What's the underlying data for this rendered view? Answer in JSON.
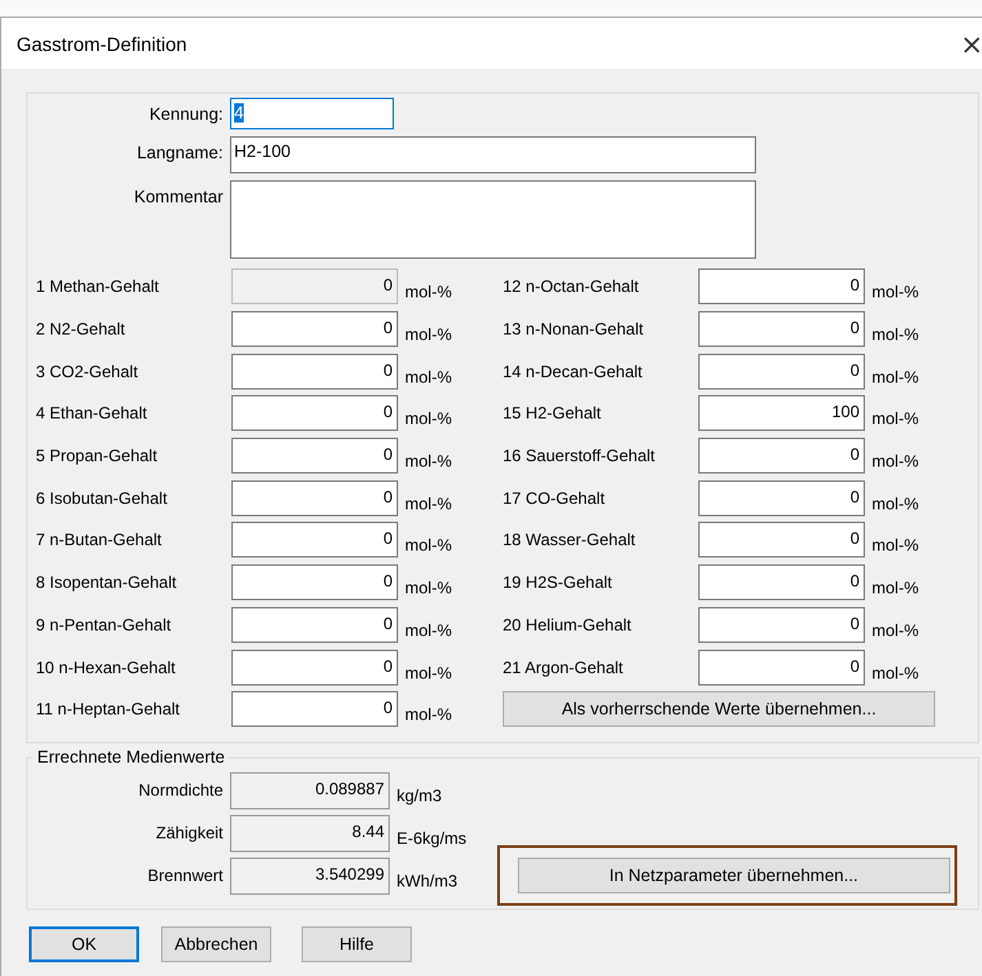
{
  "window": {
    "title": "Gasstrom-Definition",
    "close": "×"
  },
  "header_fields": [
    {
      "label": "Kennung:",
      "value": "4",
      "kind": "short",
      "focused": true,
      "text_selected": true
    },
    {
      "label": "Langname:",
      "value": "H2-100",
      "kind": "long",
      "focused": false
    },
    {
      "label": "Kommentar",
      "kind": "area",
      "focused": false
    }
  ],
  "components_left": [
    {
      "label": "1 Methan-Gehalt",
      "value": "0",
      "unit": "mol-%",
      "disabled": true
    },
    {
      "label": "2 N2-Gehalt",
      "value": "0",
      "unit": "mol-%",
      "disabled": false
    },
    {
      "label": "3 CO2-Gehalt",
      "value": "0",
      "unit": "mol-%",
      "disabled": false
    },
    {
      "label": "4 Ethan-Gehalt",
      "value": "0",
      "unit": "mol-%",
      "disabled": false
    },
    {
      "label": "5 Propan-Gehalt",
      "value": "0",
      "unit": "mol-%",
      "disabled": false
    },
    {
      "label": "6 Isobutan-Gehalt",
      "value": "0",
      "unit": "mol-%",
      "disabled": false
    },
    {
      "label": "7 n-Butan-Gehalt",
      "value": "0",
      "unit": "mol-%",
      "disabled": false
    },
    {
      "label": "8  Isopentan-Gehalt",
      "value": "0",
      "unit": "mol-%",
      "disabled": false
    },
    {
      "label": "9  n-Pentan-Gehalt",
      "value": "0",
      "unit": "mol-%",
      "disabled": false
    },
    {
      "label": "10 n-Hexan-Gehalt",
      "value": "0",
      "unit": "mol-%",
      "disabled": false
    },
    {
      "label": "11 n-Heptan-Gehalt",
      "value": "0",
      "unit": "mol-%",
      "disabled": false
    }
  ],
  "components_right": [
    {
      "label": "12 n-Octan-Gehalt",
      "value": "0",
      "unit": "mol-%",
      "disabled": false
    },
    {
      "label": "13 n-Nonan-Gehalt",
      "value": "0",
      "unit": "mol-%",
      "disabled": false
    },
    {
      "label": "14 n-Decan-Gehalt",
      "value": "0",
      "unit": "mol-%",
      "disabled": false
    },
    {
      "label": "15 H2-Gehalt",
      "value": "100",
      "unit": "mol-%",
      "disabled": false
    },
    {
      "label": "16 Sauerstoff-Gehalt",
      "value": "0",
      "unit": "mol-%",
      "disabled": false
    },
    {
      "label": "17 CO-Gehalt",
      "value": "0",
      "unit": "mol-%",
      "disabled": false
    },
    {
      "label": "18 Wasser-Gehalt",
      "value": "0",
      "unit": "mol-%",
      "disabled": false
    },
    {
      "label": "19 H2S-Gehalt",
      "value": "0",
      "unit": "mol-%",
      "disabled": false
    },
    {
      "label": "20 Helium-Gehalt",
      "value": "0",
      "unit": "mol-%",
      "disabled": false
    },
    {
      "label": "21 Argon-Gehalt",
      "value": "0",
      "unit": "mol-%",
      "disabled": false
    }
  ],
  "apply_defaults_button": "Als vorherrschende Werte übernehmen...",
  "results": {
    "title": "Errechnete Medienwerte",
    "rows": [
      {
        "label": "Normdichte",
        "value": "0.089887",
        "unit": "kg/m3"
      },
      {
        "label": "Zähigkeit",
        "value": "8.44",
        "unit": "E-6kg/ms"
      },
      {
        "label": "Brennwert",
        "value": "3.540299",
        "unit": "kWh/m3"
      }
    ],
    "apply_button": {
      "label": "In Netzparameter übernehmen...",
      "highlighted": true
    }
  },
  "buttons": [
    {
      "label": "OK",
      "default": true
    },
    {
      "label": "Abbrechen",
      "default": false
    },
    {
      "label": "Hilfe",
      "default": false
    }
  ]
}
